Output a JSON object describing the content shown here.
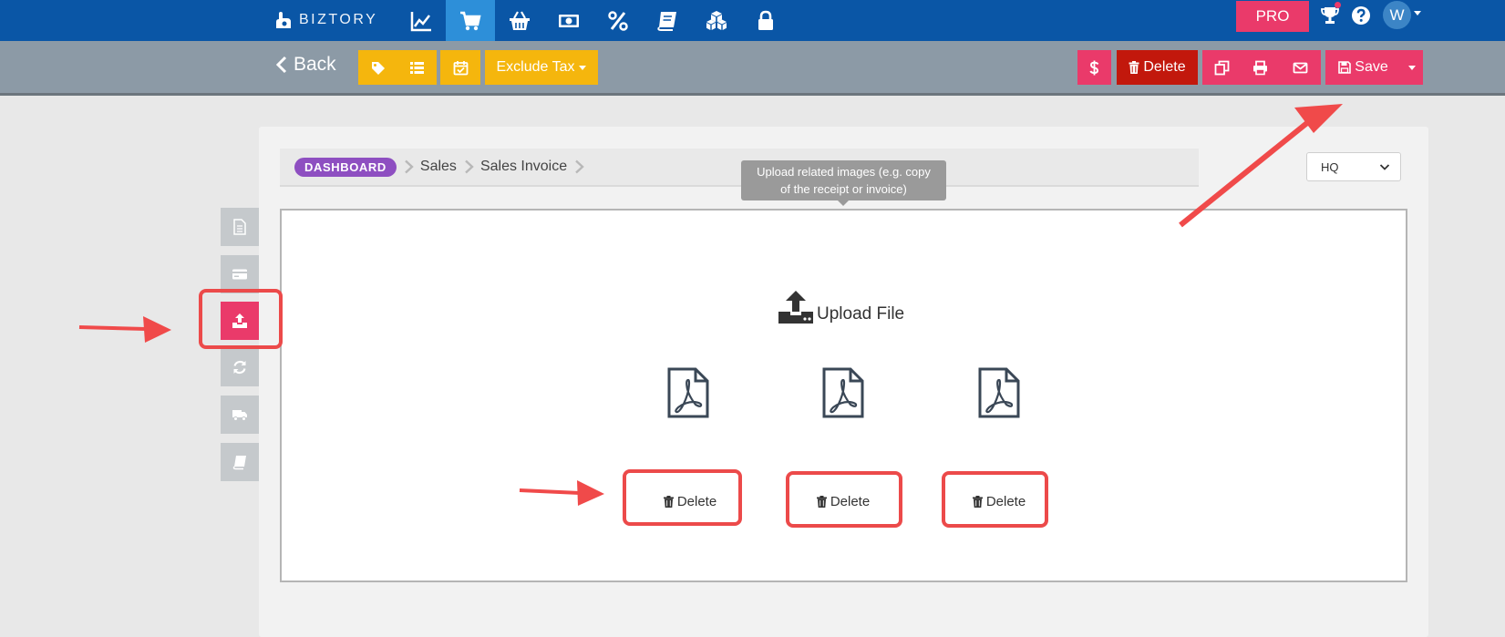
{
  "app": {
    "logo_text": "BIZTORY",
    "nav_icons": [
      "chart-line-icon",
      "cart-icon",
      "basket-icon",
      "money-icon",
      "percent-icon",
      "book-icon",
      "cubes-icon",
      "lock-icon"
    ],
    "active_nav": "cart-icon",
    "pro_label": "PRO",
    "avatar_initial": "W"
  },
  "toolbar": {
    "back_label": "Back",
    "exclude_tax_label": "Exclude Tax",
    "delete_label": "Delete",
    "save_label": "Save"
  },
  "breadcrumb": {
    "dashboard": "DASHBOARD",
    "items": [
      "Sales",
      "Sales Invoice"
    ]
  },
  "location_select": {
    "value": "HQ"
  },
  "tooltip": {
    "line1": "Upload related images (e.g. copy",
    "line2": "of the receipt or invoice)"
  },
  "upload": {
    "label": "Upload File",
    "files": [
      {
        "type": "pdf",
        "delete_label": "Delete"
      },
      {
        "type": "pdf",
        "delete_label": "Delete"
      },
      {
        "type": "pdf",
        "delete_label": "Delete"
      }
    ]
  },
  "side_tabs": [
    "document-icon",
    "credit-card-icon",
    "upload-icon",
    "refresh-icon",
    "truck-icon",
    "book-icon"
  ],
  "active_side_tab": "upload-icon",
  "colors": {
    "topbar": "#0a56a6",
    "nav_active": "#2d8fd9",
    "accent_pink": "#ea3a6a",
    "yellow": "#f5b60d",
    "danger": "#c2180c",
    "dashboard_badge": "#8e4fc1",
    "annotation_red": "#ec4a4a"
  }
}
